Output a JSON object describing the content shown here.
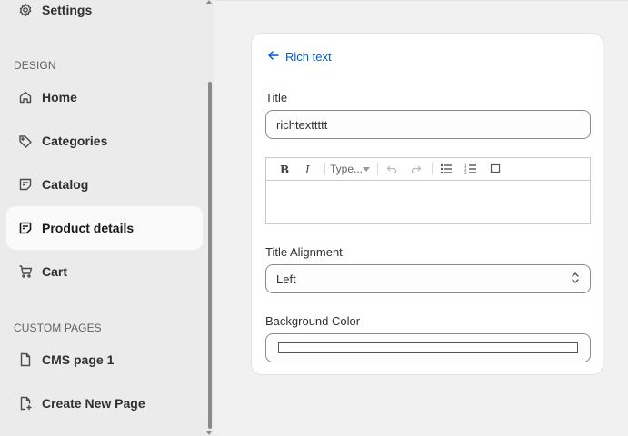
{
  "sidebar": {
    "top_item": {
      "label": "Settings",
      "icon": "gear-icon"
    },
    "design_section_label": "DESIGN",
    "items": [
      {
        "label": "Home",
        "icon": "home-icon"
      },
      {
        "label": "Categories",
        "icon": "tag-icon"
      },
      {
        "label": "Catalog",
        "icon": "catalog-icon"
      },
      {
        "label": "Product details",
        "icon": "product-details-icon",
        "active": true
      },
      {
        "label": "Cart",
        "icon": "cart-icon"
      }
    ],
    "custom_section_label": "CUSTOM PAGES",
    "custom_items": [
      {
        "label": "CMS page 1",
        "icon": "page-icon"
      },
      {
        "label": "Create New Page",
        "icon": "page-add-icon"
      }
    ]
  },
  "panel": {
    "back_label": "Rich text",
    "title_label": "Title",
    "title_value": "richtexttttt",
    "editor": {
      "type_select": "Type..."
    },
    "alignment_label": "Title Alignment",
    "alignment_value": "Left",
    "bg_color_label": "Background Color",
    "bg_color_value": "#ffffff"
  },
  "colors": {
    "link": "#005bd3",
    "sidebar_bg": "#ebebeb",
    "content_bg": "#f1f1f1"
  }
}
